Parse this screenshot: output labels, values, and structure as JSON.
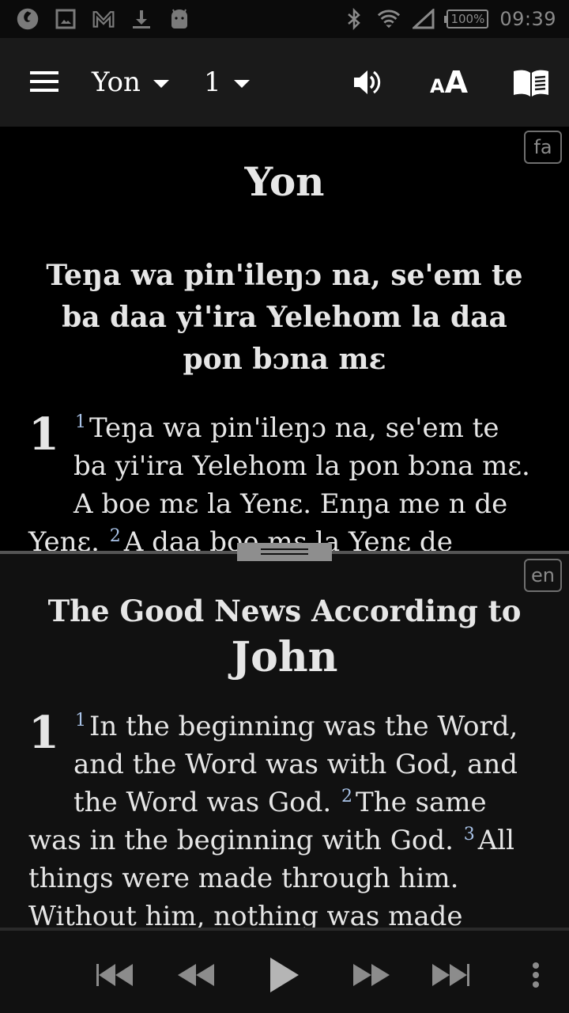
{
  "status_bar": {
    "left_icons": [
      "app-notification-icon",
      "image-icon",
      "gmail-icon",
      "download-icon",
      "android-icon"
    ],
    "right_icons": [
      "bluetooth-icon",
      "wifi-icon",
      "signal-icon"
    ],
    "battery": "100%",
    "time": "09:39"
  },
  "app_bar": {
    "book": "Yon",
    "chapter": "1",
    "actions": [
      "audio-icon",
      "text-size-icon",
      "parallel-text-icon"
    ]
  },
  "top_pane": {
    "language_badge": "fa",
    "book_title": "Yon",
    "section_heading": "Teŋa wa pin'ileŋɔ na, se'em te ba daa yi'ira Yelehom la daa pon bɔna mɛ",
    "chapter_number": "1",
    "verses": [
      {
        "num": "1",
        "text": "Teŋa wa pin'ileŋɔ na, se'em te ba yi'ira Yelehom la pon bɔna mɛ. A boe mɛ la Yenɛ. Enŋa me n de Yenɛ. "
      },
      {
        "num": "2",
        "text": "A daa boe mɛ la Yenɛ de"
      }
    ]
  },
  "bottom_pane": {
    "language_badge": "en",
    "book_subtitle": "The Good News According to",
    "book_title": "John",
    "chapter_number": "1",
    "verses": [
      {
        "num": "1",
        "text": "In the beginning was the Word, and the Word was with God, and the Word was God. "
      },
      {
        "num": "2",
        "text": "The same was in the beginning with God. "
      },
      {
        "num": "3",
        "text": "All things were made through him. Without him, nothing was made"
      }
    ]
  },
  "audio_controls": {
    "buttons": [
      "previous-chapter",
      "rewind",
      "play",
      "fast-forward",
      "next-chapter",
      "more-options"
    ]
  },
  "colors": {
    "verse_number": "#a9c3e8",
    "text": "#e6e6e6",
    "app_bar": "#1a1a1a",
    "top_pane_bg": "#000000",
    "bottom_pane_bg": "#111111"
  }
}
